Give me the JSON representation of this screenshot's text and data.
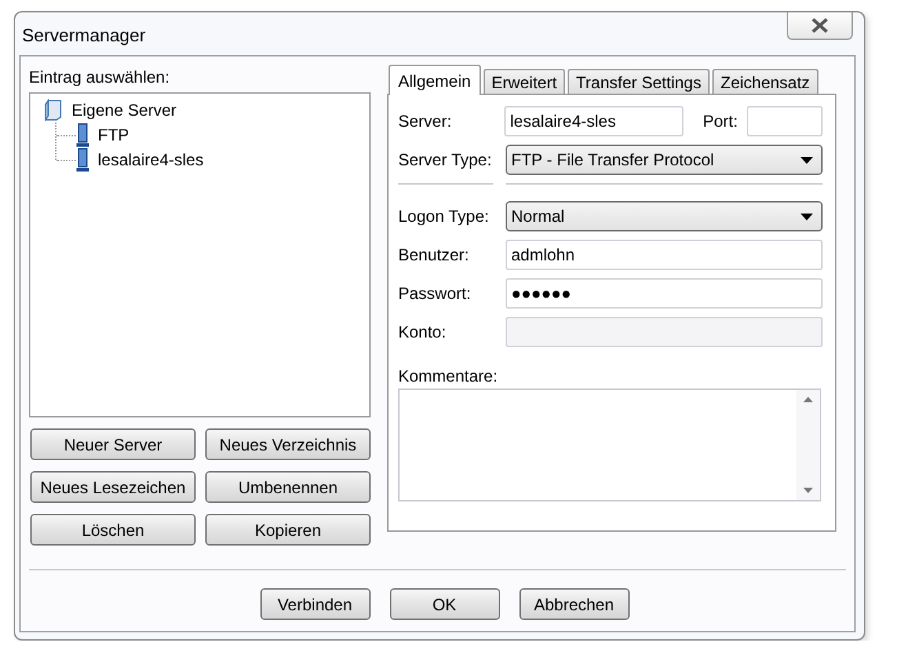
{
  "window": {
    "title": "Servermanager"
  },
  "entry_panel": {
    "label": "Eintrag auswählen:",
    "tree": [
      {
        "label": "Eigene Server",
        "kind": "folder",
        "children": [
          {
            "label": "FTP",
            "kind": "server"
          },
          {
            "label": "lesalaire4-sles",
            "kind": "server"
          }
        ]
      }
    ],
    "buttons": [
      "Neuer Server",
      "Neues Verzeichnis",
      "Neues Lesezeichen",
      "Umbenennen",
      "Löschen",
      "Kopieren"
    ]
  },
  "tabs": [
    {
      "label": "Allgemein",
      "selected": true
    },
    {
      "label": "Erweitert",
      "selected": false
    },
    {
      "label": "Transfer Settings",
      "selected": false
    },
    {
      "label": "Zeichensatz",
      "selected": false
    }
  ],
  "form": {
    "server": {
      "label": "Server:",
      "value": "lesalaire4-sles"
    },
    "port": {
      "label": "Port:"
    },
    "server_type": {
      "label": "Server Type:",
      "value": "FTP - File Transfer Protocol"
    },
    "logon_type": {
      "label": "Logon Type:",
      "value": "Normal"
    },
    "user": {
      "label": "Benutzer:",
      "value": "admlohn"
    },
    "password": {
      "label": "Passwort:",
      "value": "●●●●●●"
    },
    "account": {
      "label": "Konto:"
    },
    "comments": {
      "label": "Kommentare:"
    }
  },
  "dialog_buttons": [
    "Verbinden",
    "OK",
    "Abbrechen"
  ]
}
